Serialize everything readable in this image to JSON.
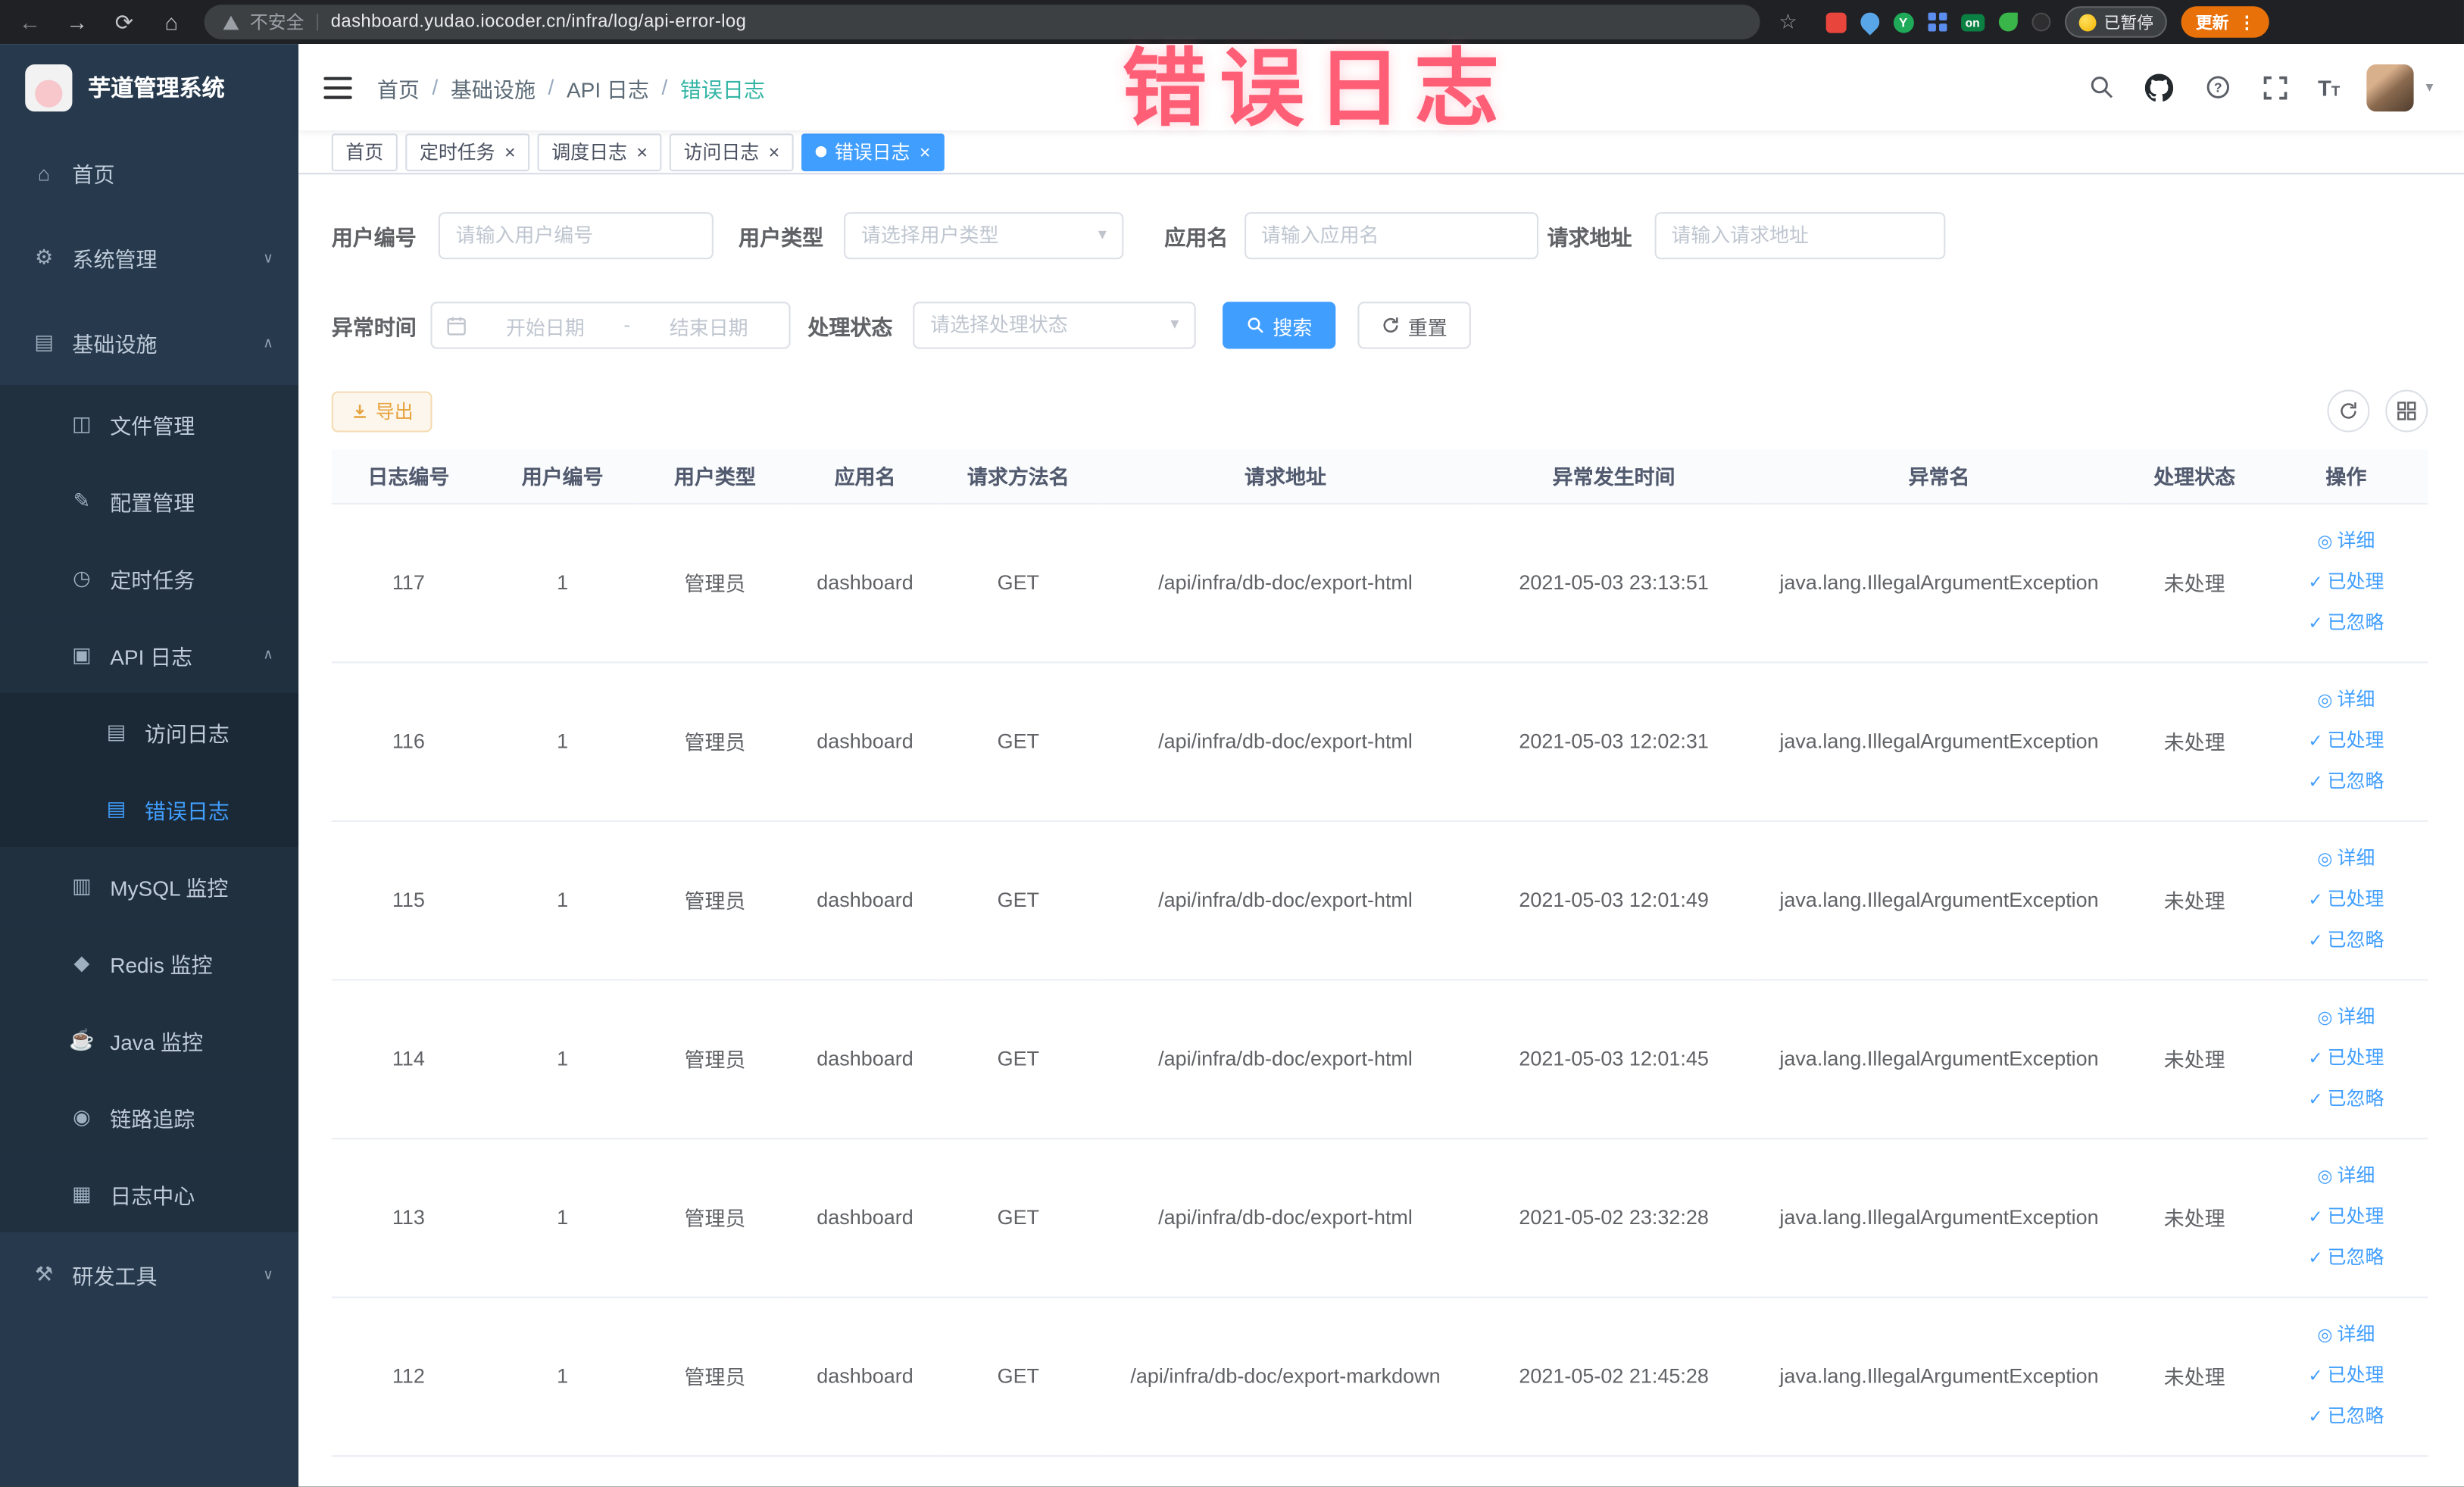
{
  "browser": {
    "security_label": "不安全",
    "url": "dashboard.yudao.iocoder.cn/infra/log/api-error-log",
    "extension_on_badge": "on",
    "extension_y_badge": "Y",
    "paused_badge_label": "已暂停",
    "update_button_label": "更新"
  },
  "watermark": "错误日志",
  "colors": {
    "primary": "#409eff",
    "warning": "#e6a23c",
    "watermark_pink": "#ff4a64",
    "sidebar_bg": "#273a4d",
    "chrome_update_orange": "#e8710a"
  },
  "sidebar": {
    "title": "芋道管理系统",
    "items": [
      {
        "key": "home",
        "label": "首页",
        "icon": "home",
        "level": 1,
        "chevron": null,
        "active": false
      },
      {
        "key": "system",
        "label": "系统管理",
        "icon": "gear",
        "level": 1,
        "chevron": "down",
        "active": false
      },
      {
        "key": "infra",
        "label": "基础设施",
        "icon": "grid",
        "level": 1,
        "chevron": "up",
        "active": false
      },
      {
        "key": "file",
        "label": "文件管理",
        "icon": "folder",
        "level": 2,
        "chevron": null,
        "active": false
      },
      {
        "key": "config",
        "label": "配置管理",
        "icon": "edit",
        "level": 2,
        "chevron": null,
        "active": false
      },
      {
        "key": "job",
        "label": "定时任务",
        "icon": "clock",
        "level": 2,
        "chevron": null,
        "active": false
      },
      {
        "key": "api-log",
        "label": "API 日志",
        "icon": "api",
        "level": 2,
        "chevron": "up",
        "active": false
      },
      {
        "key": "access-log",
        "label": "访问日志",
        "icon": "doc",
        "level": 3,
        "chevron": null,
        "active": false
      },
      {
        "key": "error-log",
        "label": "错误日志",
        "icon": "doc",
        "level": 3,
        "chevron": null,
        "active": true
      },
      {
        "key": "mysql",
        "label": "MySQL 监控",
        "icon": "db",
        "level": 2,
        "chevron": null,
        "active": false
      },
      {
        "key": "redis",
        "label": "Redis 监控",
        "icon": "redis",
        "level": 2,
        "chevron": null,
        "active": false
      },
      {
        "key": "java",
        "label": "Java 监控",
        "icon": "java",
        "level": 2,
        "chevron": null,
        "active": false
      },
      {
        "key": "trace",
        "label": "链路追踪",
        "icon": "eye",
        "level": 2,
        "chevron": null,
        "active": false
      },
      {
        "key": "log-center",
        "label": "日志中心",
        "icon": "log",
        "level": 2,
        "chevron": null,
        "active": false
      },
      {
        "key": "dev-tools",
        "label": "研发工具",
        "icon": "tools",
        "level": 1,
        "chevron": "down",
        "active": false
      }
    ]
  },
  "header": {
    "breadcrumb": [
      {
        "key": "home",
        "label": "首页"
      },
      {
        "key": "infra",
        "label": "基础设施"
      },
      {
        "key": "api-log",
        "label": "API 日志"
      },
      {
        "key": "error-log",
        "label": "错误日志"
      }
    ]
  },
  "tabs": [
    {
      "key": "home",
      "label": "首页",
      "closable": false,
      "active": false
    },
    {
      "key": "job",
      "label": "定时任务",
      "closable": true,
      "active": false
    },
    {
      "key": "job-log",
      "label": "调度日志",
      "closable": true,
      "active": false
    },
    {
      "key": "access-log",
      "label": "访问日志",
      "closable": true,
      "active": false
    },
    {
      "key": "error-log",
      "label": "错误日志",
      "closable": true,
      "active": true
    }
  ],
  "filters": {
    "user_id_label": "用户编号",
    "user_id_placeholder": "请输入用户编号",
    "user_type_label": "用户类型",
    "user_type_placeholder": "请选择用户类型",
    "app_name_label": "应用名",
    "app_name_placeholder": "请输入应用名",
    "request_url_label": "请求地址",
    "request_url_placeholder": "请输入请求地址",
    "exception_time_label": "异常时间",
    "start_date_placeholder": "开始日期",
    "range_separator": "-",
    "end_date_placeholder": "结束日期",
    "process_status_label": "处理状态",
    "process_status_placeholder": "请选择处理状态",
    "search_button": "搜索",
    "reset_button": "重置"
  },
  "toolbar": {
    "export_button": "导出"
  },
  "table": {
    "columns": [
      "日志编号",
      "用户编号",
      "用户类型",
      "应用名",
      "请求方法名",
      "请求地址",
      "异常发生时间",
      "异常名",
      "处理状态",
      "操作"
    ],
    "actions": [
      {
        "key": "detail",
        "label": "详细",
        "icon": "eye"
      },
      {
        "key": "processed",
        "label": "已处理",
        "icon": "check"
      },
      {
        "key": "ignored",
        "label": "已忽略",
        "icon": "check"
      }
    ],
    "rows": [
      {
        "id": "117",
        "user_id": "1",
        "user_type": "管理员",
        "app": "dashboard",
        "method": "GET",
        "url": "/api/infra/db-doc/export-html",
        "time": "2021-05-03 23:13:51",
        "exception": "java.lang.IllegalArgumentException",
        "status": "未处理"
      },
      {
        "id": "116",
        "user_id": "1",
        "user_type": "管理员",
        "app": "dashboard",
        "method": "GET",
        "url": "/api/infra/db-doc/export-html",
        "time": "2021-05-03 12:02:31",
        "exception": "java.lang.IllegalArgumentException",
        "status": "未处理"
      },
      {
        "id": "115",
        "user_id": "1",
        "user_type": "管理员",
        "app": "dashboard",
        "method": "GET",
        "url": "/api/infra/db-doc/export-html",
        "time": "2021-05-03 12:01:49",
        "exception": "java.lang.IllegalArgumentException",
        "status": "未处理"
      },
      {
        "id": "114",
        "user_id": "1",
        "user_type": "管理员",
        "app": "dashboard",
        "method": "GET",
        "url": "/api/infra/db-doc/export-html",
        "time": "2021-05-03 12:01:45",
        "exception": "java.lang.IllegalArgumentException",
        "status": "未处理"
      },
      {
        "id": "113",
        "user_id": "1",
        "user_type": "管理员",
        "app": "dashboard",
        "method": "GET",
        "url": "/api/infra/db-doc/export-html",
        "time": "2021-05-02 23:32:28",
        "exception": "java.lang.IllegalArgumentException",
        "status": "未处理"
      },
      {
        "id": "112",
        "user_id": "1",
        "user_type": "管理员",
        "app": "dashboard",
        "method": "GET",
        "url": "/api/infra/db-doc/export-markdown",
        "time": "2021-05-02 21:45:28",
        "exception": "java.lang.IllegalArgumentException",
        "status": "未处理"
      }
    ]
  }
}
